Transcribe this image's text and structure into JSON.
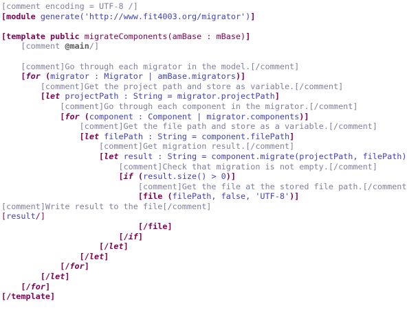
{
  "colors": {
    "comment": "#7f7f9f",
    "keyword": "#7f0055",
    "identifier": "#3f3fbf",
    "string": "#3f3fbf",
    "operator": "#3f3fbf",
    "main_tag": "#5a5a5a",
    "plain": "#000000"
  },
  "lines": [
    {
      "indent": 0,
      "tokens": [
        {
          "t": "[comment encoding = UTF-8 /]",
          "c": "comment"
        }
      ]
    },
    {
      "indent": 0,
      "tokens": [
        {
          "t": "[module ",
          "c": "keyword",
          "b": true
        },
        {
          "t": "generate",
          "c": "identifier"
        },
        {
          "t": "(",
          "c": "operator"
        },
        {
          "t": "'http://www.fit4003.org/migrator'",
          "c": "string"
        },
        {
          "t": ")",
          "c": "operator"
        },
        {
          "t": "]",
          "c": "keyword",
          "b": true
        }
      ]
    },
    {
      "indent": 0,
      "tokens": []
    },
    {
      "indent": 0,
      "tokens": [
        {
          "t": "[template public ",
          "c": "keyword",
          "b": true
        },
        {
          "t": "migrateComponents",
          "c": "keyword"
        },
        {
          "t": "(amBase : mBase)",
          "c": "keyword"
        },
        {
          "t": "]",
          "c": "keyword",
          "b": true
        }
      ]
    },
    {
      "indent": 1,
      "tokens": [
        {
          "t": "[comment ",
          "c": "comment"
        },
        {
          "t": "@main",
          "c": "main_tag",
          "b": true
        },
        {
          "t": "/]",
          "c": "comment"
        }
      ]
    },
    {
      "indent": 0,
      "tokens": []
    },
    {
      "indent": 1,
      "tokens": [
        {
          "t": "[comment]Go through each migrator in the model.[/comment]",
          "c": "comment"
        }
      ]
    },
    {
      "indent": 1,
      "tokens": [
        {
          "t": "[",
          "c": "keyword",
          "b": true
        },
        {
          "t": "for",
          "c": "keyword",
          "b": true,
          "i": true
        },
        {
          "t": " (",
          "c": "keyword",
          "b": true
        },
        {
          "t": "migrator : Migrator | amBase.migrators",
          "c": "identifier"
        },
        {
          "t": ")]",
          "c": "keyword",
          "b": true
        }
      ]
    },
    {
      "indent": 2,
      "tokens": [
        {
          "t": "[comment]Get the project path and store as variable.[/comment]",
          "c": "comment"
        }
      ]
    },
    {
      "indent": 2,
      "tokens": [
        {
          "t": "[",
          "c": "keyword",
          "b": true
        },
        {
          "t": "let",
          "c": "keyword",
          "b": true,
          "i": true
        },
        {
          "t": " projectPath : String = migrator.projectPath",
          "c": "identifier"
        },
        {
          "t": "]",
          "c": "keyword",
          "b": true
        }
      ]
    },
    {
      "indent": 3,
      "tokens": [
        {
          "t": "[comment]Go through each component in the migrator.[/comment]",
          "c": "comment"
        }
      ]
    },
    {
      "indent": 3,
      "tokens": [
        {
          "t": "[",
          "c": "keyword",
          "b": true
        },
        {
          "t": "for",
          "c": "keyword",
          "b": true,
          "i": true
        },
        {
          "t": " (",
          "c": "keyword",
          "b": true
        },
        {
          "t": "component : Component | migrator.components",
          "c": "identifier"
        },
        {
          "t": ")]",
          "c": "keyword",
          "b": true
        }
      ]
    },
    {
      "indent": 4,
      "tokens": [
        {
          "t": "[comment]Get the file path and store as a variable.[/comment]",
          "c": "comment"
        }
      ]
    },
    {
      "indent": 4,
      "tokens": [
        {
          "t": "[",
          "c": "keyword",
          "b": true
        },
        {
          "t": "let",
          "c": "keyword",
          "b": true,
          "i": true
        },
        {
          "t": " filePath : String = component.filePath",
          "c": "identifier"
        },
        {
          "t": "]",
          "c": "keyword",
          "b": true
        }
      ]
    },
    {
      "indent": 5,
      "tokens": [
        {
          "t": "[comment]Get migration result.[/comment]",
          "c": "comment"
        }
      ]
    },
    {
      "indent": 5,
      "tokens": [
        {
          "t": "[",
          "c": "keyword",
          "b": true
        },
        {
          "t": "let",
          "c": "keyword",
          "b": true,
          "i": true
        },
        {
          "t": " result : String = component.migrate(projectPath, filePath)",
          "c": "identifier"
        },
        {
          "t": "]",
          "c": "keyword",
          "b": true
        }
      ]
    },
    {
      "indent": 6,
      "tokens": [
        {
          "t": "[comment]Check that migration is not empty.[/comment]",
          "c": "comment"
        }
      ]
    },
    {
      "indent": 6,
      "tokens": [
        {
          "t": "[",
          "c": "keyword",
          "b": true
        },
        {
          "t": "if",
          "c": "keyword",
          "b": true,
          "i": true
        },
        {
          "t": " (",
          "c": "keyword",
          "b": true
        },
        {
          "t": "result.size() > 0",
          "c": "identifier"
        },
        {
          "t": ")]",
          "c": "keyword",
          "b": true
        }
      ]
    },
    {
      "indent": 7,
      "tokens": [
        {
          "t": "[comment]Get the file at the stored file path.[/comment]",
          "c": "comment"
        }
      ]
    },
    {
      "indent": 7,
      "tokens": [
        {
          "t": "[file (",
          "c": "keyword",
          "b": true
        },
        {
          "t": "filePath, false, 'UTF-8'",
          "c": "identifier"
        },
        {
          "t": ")]",
          "c": "keyword",
          "b": true
        }
      ]
    },
    {
      "indent": 0,
      "tokens": [
        {
          "t": "[comment]Write result to the file[/comment]",
          "c": "comment"
        }
      ]
    },
    {
      "indent": 0,
      "tokens": [
        {
          "t": "[",
          "c": "keyword"
        },
        {
          "t": "result",
          "c": "identifier"
        },
        {
          "t": "/]",
          "c": "keyword"
        }
      ]
    },
    {
      "indent": 7,
      "tokens": [
        {
          "t": "[/file]",
          "c": "keyword",
          "b": true
        }
      ]
    },
    {
      "indent": 6,
      "tokens": [
        {
          "t": "[/",
          "c": "keyword",
          "b": true
        },
        {
          "t": "if",
          "c": "keyword",
          "b": true,
          "i": true
        },
        {
          "t": "]",
          "c": "keyword",
          "b": true
        }
      ]
    },
    {
      "indent": 5,
      "tokens": [
        {
          "t": "[/",
          "c": "keyword",
          "b": true
        },
        {
          "t": "let",
          "c": "keyword",
          "b": true,
          "i": true
        },
        {
          "t": "]",
          "c": "keyword",
          "b": true
        }
      ]
    },
    {
      "indent": 4,
      "tokens": [
        {
          "t": "[/",
          "c": "keyword",
          "b": true
        },
        {
          "t": "let",
          "c": "keyword",
          "b": true,
          "i": true
        },
        {
          "t": "]",
          "c": "keyword",
          "b": true
        }
      ]
    },
    {
      "indent": 3,
      "tokens": [
        {
          "t": "[/",
          "c": "keyword",
          "b": true
        },
        {
          "t": "for",
          "c": "keyword",
          "b": true,
          "i": true
        },
        {
          "t": "]",
          "c": "keyword",
          "b": true
        }
      ]
    },
    {
      "indent": 2,
      "tokens": [
        {
          "t": "[/",
          "c": "keyword",
          "b": true
        },
        {
          "t": "let",
          "c": "keyword",
          "b": true,
          "i": true
        },
        {
          "t": "]",
          "c": "keyword",
          "b": true
        }
      ]
    },
    {
      "indent": 1,
      "tokens": [
        {
          "t": "[/",
          "c": "keyword",
          "b": true
        },
        {
          "t": "for",
          "c": "keyword",
          "b": true,
          "i": true
        },
        {
          "t": "]",
          "c": "keyword",
          "b": true
        }
      ]
    },
    {
      "indent": 0,
      "tokens": [
        {
          "t": "[/template]",
          "c": "keyword",
          "b": true
        }
      ]
    }
  ]
}
